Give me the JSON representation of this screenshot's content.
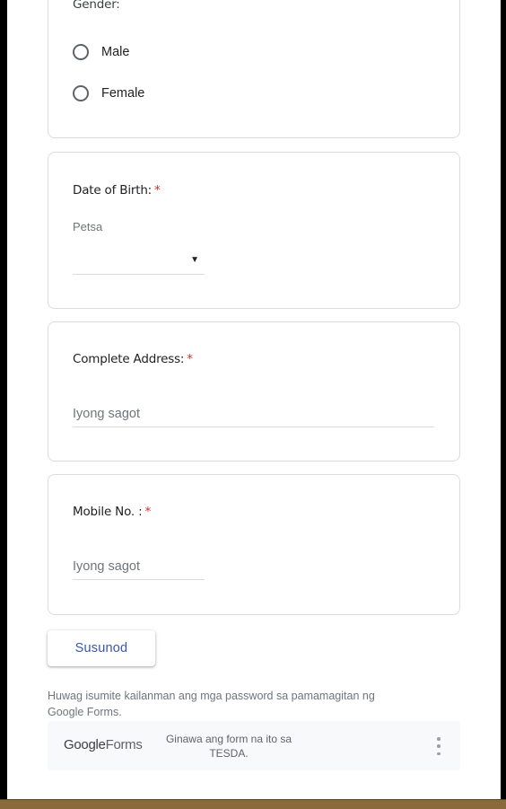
{
  "gender_question": {
    "title_partial": "Gender:",
    "options": [
      "Male",
      "Female"
    ]
  },
  "dob_question": {
    "title": "Date of Birth:",
    "required_mark": "*",
    "sub_label": "Petsa",
    "dropdown_arrow": "▼"
  },
  "address_question": {
    "title": "Complete Address:",
    "required_mark": "*",
    "placeholder": "Iyong sagot"
  },
  "mobile_question": {
    "title": "Mobile No. :",
    "required_mark": "*",
    "placeholder": "Iyong sagot"
  },
  "navigation": {
    "next_label": "Susunod"
  },
  "footer": {
    "warning_line1": "Huwag isumite kailanman ang mga password sa pamamagitan ng",
    "warning_line2": "Google Forms.",
    "logo_google": "Google",
    "logo_forms": "Forms",
    "made_by_line1": "Ginawa ang form na ito sa",
    "made_by_line2": "TESDA."
  },
  "colors": {
    "required": "#d93025",
    "accent": "#3a57a7"
  }
}
